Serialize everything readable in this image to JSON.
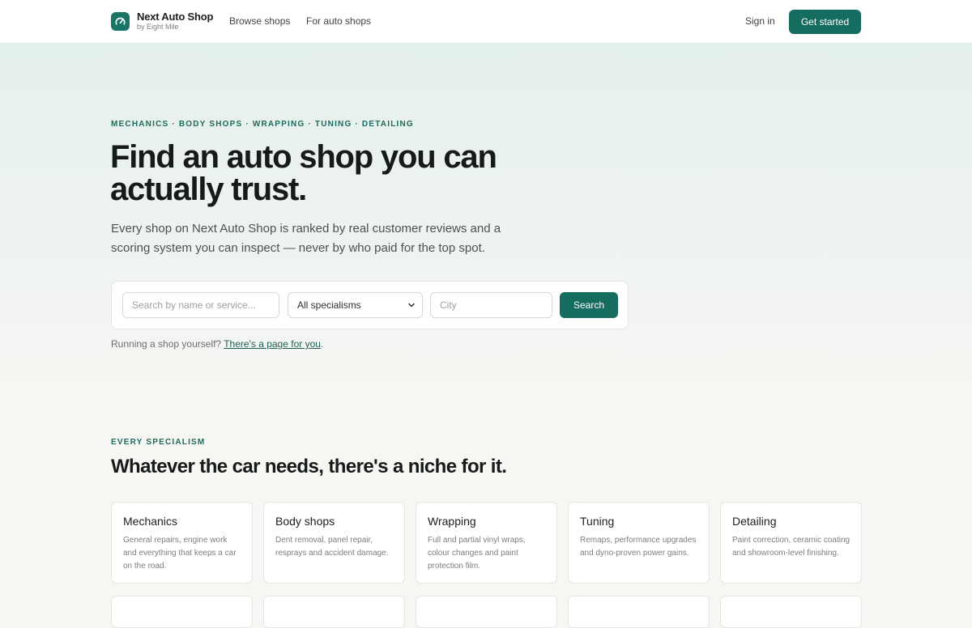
{
  "header": {
    "brand_name": "Next Auto Shop",
    "brand_sub": "by Eight Mile",
    "nav": [
      "Browse shops",
      "For auto shops"
    ],
    "sign_in": "Sign in",
    "get_started": "Get started"
  },
  "hero": {
    "eyebrow": "MECHANICS · BODY SHOPS · WRAPPING · TUNING · DETAILING",
    "title": "Find an auto shop you can actually trust.",
    "lead": "Every shop on Next Auto Shop is ranked by real customer reviews and a scoring system you can inspect — never by who paid for the top spot.",
    "search": {
      "placeholder": "Search by name or service...",
      "specialism_selected": "All specialisms",
      "city_placeholder": "City",
      "button": "Search"
    },
    "shop_note_text": "Running a shop yourself?",
    "shop_note_link": "There's a page for you",
    "shop_note_end": "."
  },
  "specialisms": {
    "eyebrow": "EVERY SPECIALISM",
    "title": "Whatever the car needs, there's a niche for it.",
    "cards": [
      {
        "title": "Mechanics",
        "desc": "General repairs, engine work and everything that keeps a car on the road."
      },
      {
        "title": "Body shops",
        "desc": "Dent removal, panel repair, resprays and accident damage."
      },
      {
        "title": "Wrapping",
        "desc": "Full and partial vinyl wraps, colour changes and paint protection film."
      },
      {
        "title": "Tuning",
        "desc": "Remaps, performance upgrades and dyno-proven power gains."
      },
      {
        "title": "Detailing",
        "desc": "Paint correction, ceramic coating and showroom-level finishing."
      }
    ]
  },
  "colors": {
    "accent": "#156d5f",
    "hero_bg": "#e4f0ec",
    "page_bg": "#f6f6f3"
  },
  "icons": {
    "logo": "gauge-icon",
    "select": "chevron-down-icon"
  }
}
